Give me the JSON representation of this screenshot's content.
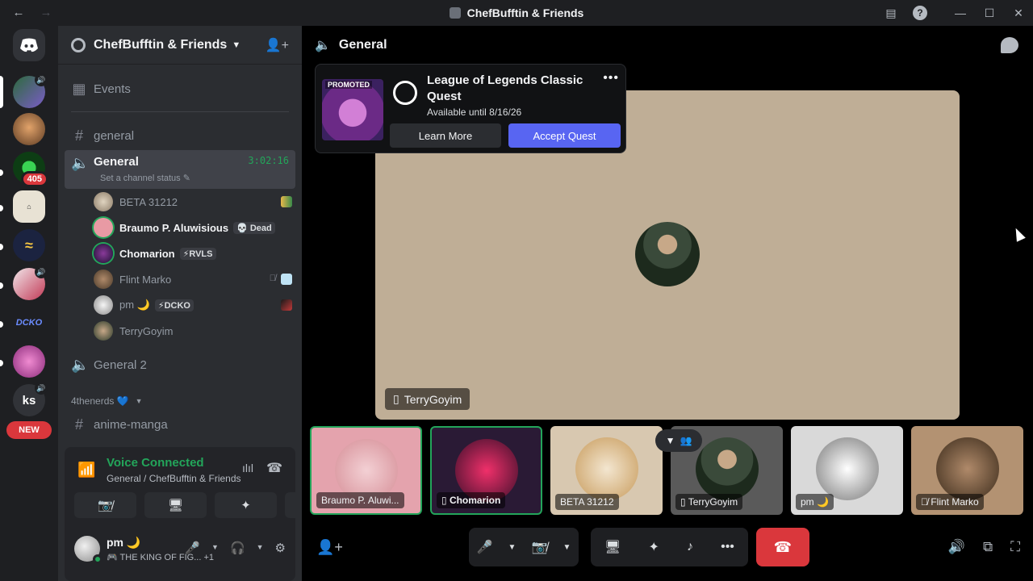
{
  "titlebar": {
    "back": "←",
    "forward": "→",
    "title": "ChefBufftin & Friends",
    "inbox_icon": "inbox-icon",
    "help": "?",
    "minimize": "—",
    "maximize": "☐",
    "close": "✕"
  },
  "rail": {
    "home_icon": "discord-logo-icon",
    "servers": [
      {
        "badge": "",
        "speaking": true
      },
      {
        "badge": ""
      },
      {
        "badge": "405"
      },
      {
        "badge": ""
      },
      {
        "badge": ""
      },
      {
        "badge": "",
        "speaking": true
      },
      {
        "badge": ""
      },
      {
        "badge": ""
      },
      {
        "label": "ks",
        "speaking": true
      }
    ],
    "new_label": "NEW"
  },
  "sidebar": {
    "server_name": "ChefBufftin & Friends",
    "channels": {
      "events": "Events",
      "general_text": "general",
      "general_voice": "General",
      "general_timer": "3:02:16",
      "general_status": "Set a channel status",
      "general2": "General 2",
      "category": "4thenerds 💙",
      "anime": "anime-manga"
    },
    "voice_users": [
      {
        "name": "BETA 31212",
        "tag": ""
      },
      {
        "name": "Braumo P. Aluwisious",
        "tag": "💀 Dead"
      },
      {
        "name": "Chomarion",
        "tag": "⚡RVLS"
      },
      {
        "name": "Flint Marko",
        "tag": ""
      },
      {
        "name": "pm 🌙",
        "tag": "⚡DCKO"
      },
      {
        "name": "TerryGoyim",
        "tag": ""
      }
    ]
  },
  "voice_panel": {
    "connected": "Voice Connected",
    "location": "General / ChefBufftin & Friends",
    "me_name": "pm 🌙",
    "me_status": "🎮 THE KING OF FIG...",
    "me_extra": "+1"
  },
  "stage": {
    "channel": "General",
    "main_tile_user": "TerryGoyim",
    "quest": {
      "promo": "PROMOTED",
      "title": "League of Legends Classic Quest",
      "available": "Available until 8/16/26",
      "learn_more": "Learn More",
      "accept": "Accept Quest"
    },
    "tiles": [
      {
        "name": "Braumo P. Aluwi...",
        "color": "#e4a3ad",
        "speaking": true
      },
      {
        "name": "Chomarion",
        "color": "#2a1a35",
        "speaking": true,
        "mobile": true
      },
      {
        "name": "BETA 31212",
        "color": "#d8c8b0"
      },
      {
        "name": "TerryGoyim",
        "color": "#5a5a5a",
        "mobile": true
      },
      {
        "name": "pm 🌙",
        "color": "#d9d9d9"
      },
      {
        "name": "Flint Marko",
        "color": "#b39272",
        "muted": true
      }
    ]
  },
  "colors": {
    "accent": "#5865f2",
    "success": "#23a55a",
    "danger": "#da373c"
  }
}
